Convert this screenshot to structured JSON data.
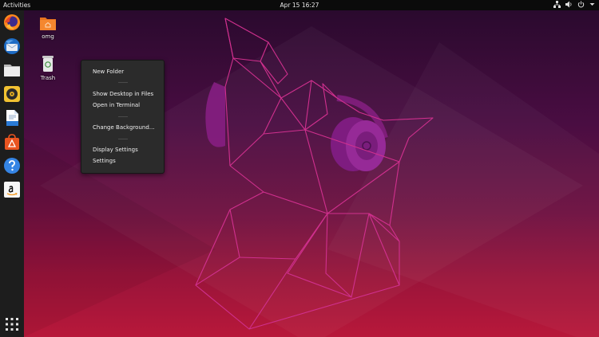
{
  "topbar": {
    "activities": "Activities",
    "clock": "Apr 15  16:27",
    "tray_icons": [
      "network-icon",
      "volume-icon",
      "power-icon",
      "system-menu-arrow-icon"
    ]
  },
  "dock": {
    "items": [
      {
        "name": "Firefox",
        "icon": "firefox-icon"
      },
      {
        "name": "Thunderbird",
        "icon": "thunderbird-icon"
      },
      {
        "name": "Files",
        "icon": "files-icon"
      },
      {
        "name": "Rhythmbox",
        "icon": "rhythmbox-icon"
      },
      {
        "name": "LibreOffice Writer",
        "icon": "writer-icon"
      },
      {
        "name": "Ubuntu Software",
        "icon": "software-icon"
      },
      {
        "name": "Help",
        "icon": "help-icon"
      },
      {
        "name": "Amazon",
        "icon": "amazon-icon"
      }
    ],
    "show_apps_icon": "apps-grid-icon"
  },
  "desktop": {
    "icons": [
      {
        "label": "omg",
        "icon": "folder-home-icon"
      },
      {
        "label": "Trash",
        "icon": "trash-icon"
      }
    ]
  },
  "context_menu": {
    "new_folder": "New Folder",
    "show_desktop": "Show Desktop in Files",
    "open_terminal": "Open in Terminal",
    "change_background": "Change Background…",
    "display_settings": "Display Settings",
    "settings": "Settings"
  },
  "colors": {
    "topbar": "#0b0b0b",
    "dock": "#1d1d1d",
    "menu_bg": "#2b2b2b",
    "wallpaper_top": "#2a0a2e",
    "wallpaper_bottom": "#b8183a",
    "mascot_line": "#d0308e"
  }
}
